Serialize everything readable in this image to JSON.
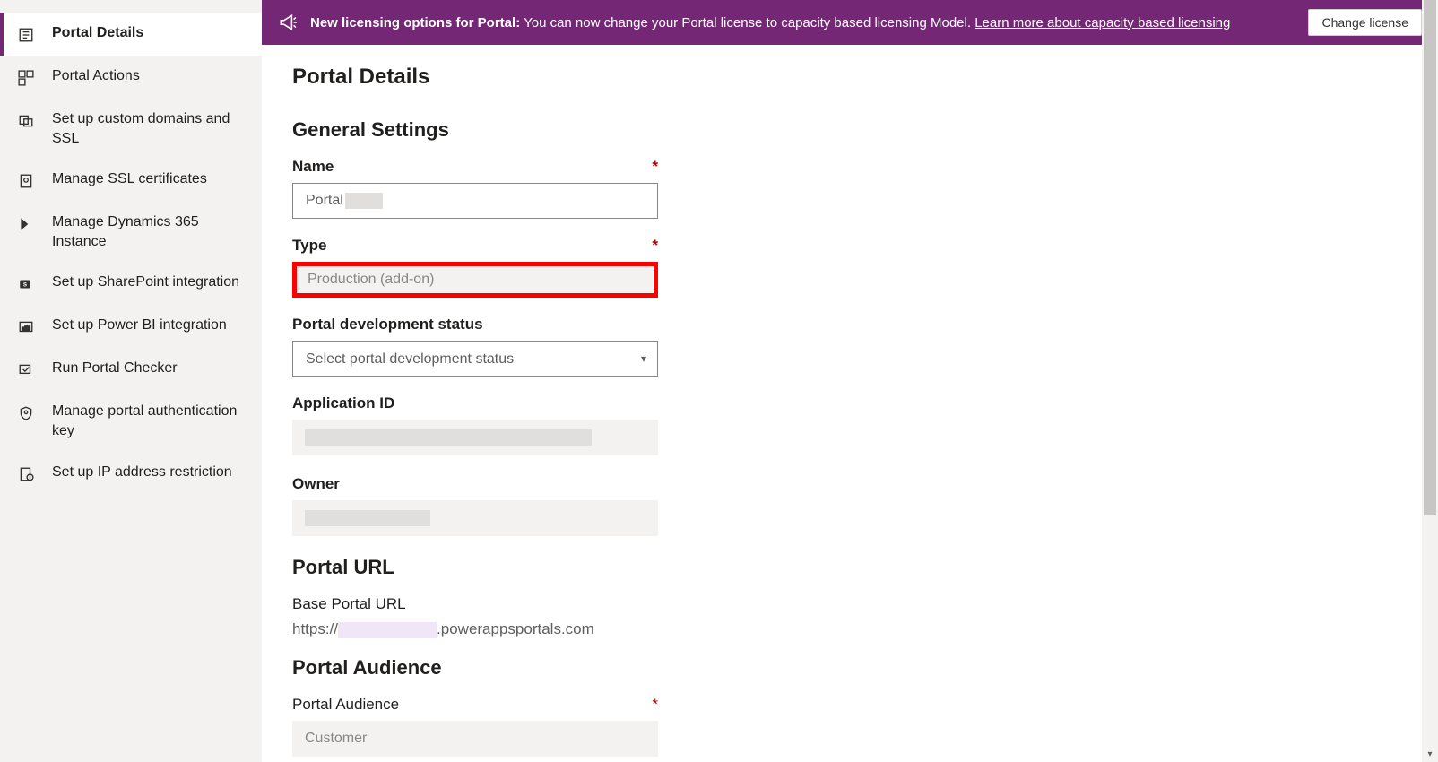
{
  "sidebar": {
    "items": [
      {
        "label": "Portal Details",
        "active": true
      },
      {
        "label": "Portal Actions"
      },
      {
        "label": "Set up custom domains and SSL"
      },
      {
        "label": "Manage SSL certificates"
      },
      {
        "label": "Manage Dynamics 365 Instance"
      },
      {
        "label": "Set up SharePoint integration"
      },
      {
        "label": "Set up Power BI integration"
      },
      {
        "label": "Run Portal Checker"
      },
      {
        "label": "Manage portal authentication key"
      },
      {
        "label": "Set up IP address restriction"
      }
    ]
  },
  "banner": {
    "title": "New licensing options for Portal:",
    "message": "You can now change your Portal license to capacity based licensing Model.",
    "link_text": "Learn more about capacity based licensing",
    "button": "Change license"
  },
  "page": {
    "title": "Portal Details"
  },
  "sections": {
    "general": {
      "heading": "General Settings",
      "name_label": "Name",
      "name_value": "Portal",
      "type_label": "Type",
      "type_value": "Production (add-on)",
      "dev_status_label": "Portal development status",
      "dev_status_placeholder": "Select portal development status",
      "app_id_label": "Application ID",
      "owner_label": "Owner"
    },
    "url": {
      "heading": "Portal URL",
      "base_label": "Base Portal URL",
      "prefix": "https://",
      "suffix": ".powerappsportals.com"
    },
    "audience": {
      "heading": "Portal Audience",
      "label": "Portal Audience",
      "value": "Customer"
    }
  }
}
